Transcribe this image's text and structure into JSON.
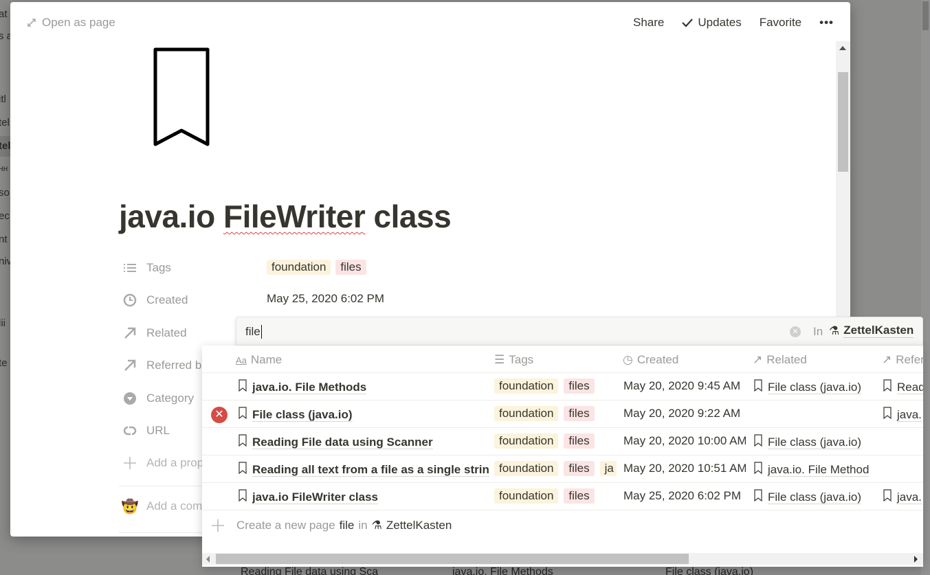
{
  "background": {
    "sidebar_fragments": [
      "at",
      "s a",
      "itl",
      "tel",
      "tel",
      "нн",
      "so",
      "ec",
      "nt",
      "niv",
      "lii",
      "te"
    ],
    "bottom_row": [
      "Reading File data using Sca",
      "java.io. File Methods",
      "File class (java.io)"
    ]
  },
  "topbar": {
    "open_as_page": "Open as page",
    "share": "Share",
    "updates": "Updates",
    "favorite": "Favorite",
    "more": "•••"
  },
  "page": {
    "icon": "bookmark-icon",
    "title_parts": [
      "java.io ",
      "FileWriter",
      " class"
    ],
    "properties": [
      {
        "name": "Tags",
        "icon": "list-icon"
      },
      {
        "name": "Created",
        "icon": "clock-icon",
        "value": "May 25, 2020 6:02 PM"
      },
      {
        "name": "Related",
        "icon": "arrow-up-right-icon"
      },
      {
        "name": "Referred b",
        "icon": "arrow-up-right-icon"
      },
      {
        "name": "Category",
        "icon": "select-icon"
      },
      {
        "name": "URL",
        "icon": "link-icon"
      },
      {
        "name": "Add a prop",
        "icon": "plus-icon"
      }
    ],
    "tags": [
      "foundation",
      "files"
    ],
    "comment_placeholder": "Add a com"
  },
  "search": {
    "query": "file",
    "in_label": "In",
    "workspace": "ZettelKasten"
  },
  "results": {
    "columns": [
      "Name",
      "Tags",
      "Created",
      "Related",
      "Refer"
    ],
    "rows": [
      {
        "name": "java.io. File Methods",
        "tags": [
          "foundation",
          "files"
        ],
        "created": "May 20, 2020 9:45 AM",
        "related": "File class (java.io)",
        "referred": "Read"
      },
      {
        "name": "File class (java.io)",
        "tags": [
          "foundation",
          "files"
        ],
        "created": "May 20, 2020 9:22 AM",
        "related": "",
        "referred": "java.",
        "selected": true
      },
      {
        "name": "Reading File data using Scanner",
        "tags": [
          "foundation",
          "files"
        ],
        "created": "May 20, 2020 10:00 AM",
        "related": "File class (java.io)",
        "referred": ""
      },
      {
        "name": "Reading all text from a file as a single strin",
        "tags": [
          "foundation",
          "files",
          "ja"
        ],
        "created": "May 20, 2020 10:51 AM",
        "related": "java.io. File Method",
        "referred": ""
      },
      {
        "name": "java.io FileWriter class",
        "tags": [
          "foundation",
          "files"
        ],
        "created": "May 25, 2020 6:02 PM",
        "related": "File class (java.io)",
        "referred": "java."
      }
    ],
    "create": {
      "prefix": "Create a new page",
      "query": "file",
      "in": "in",
      "workspace": "ZettelKasten"
    }
  },
  "colors": {
    "tag_foundation": "#fbf3db",
    "tag_files": "#fbe4e4",
    "remove": "#d44c47"
  }
}
